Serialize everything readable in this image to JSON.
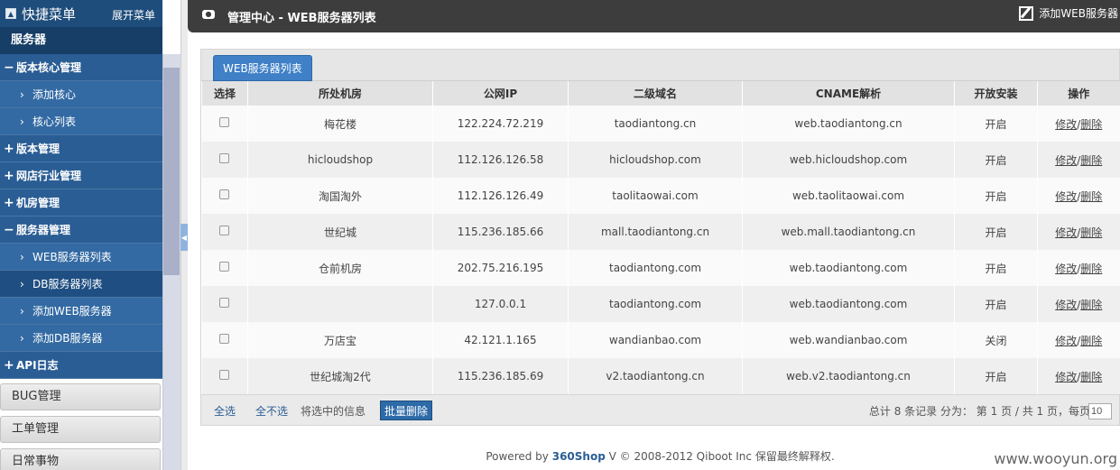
{
  "sidebar": {
    "title": "快捷菜单",
    "expand_label": "展开菜单",
    "group_label": "服务器",
    "items": [
      {
        "sign": "−",
        "label": "版本核心管理"
      },
      {
        "label": "添加核心"
      },
      {
        "label": "核心列表"
      },
      {
        "sign": "+",
        "label": "版本管理"
      },
      {
        "sign": "+",
        "label": "网店行业管理"
      },
      {
        "sign": "+",
        "label": "机房管理"
      },
      {
        "sign": "−",
        "label": "服务器管理"
      },
      {
        "label": "WEB服务器列表"
      },
      {
        "label": "DB服务器列表"
      },
      {
        "label": "添加WEB服务器"
      },
      {
        "label": "添加DB服务器"
      },
      {
        "sign": "+",
        "label": "API日志"
      }
    ],
    "bottom": [
      "BUG管理",
      "工单管理",
      "日常事物"
    ]
  },
  "header": {
    "title": "管理中心 - WEB服务器列表",
    "add_label": "添加WEB服务器"
  },
  "tab": {
    "label": "WEB服务器列表"
  },
  "table": {
    "headers": [
      "选择",
      "所处机房",
      "公网IP",
      "二级域名",
      "CNAME解析",
      "开放安装",
      "操作"
    ],
    "edit_label": "修改",
    "separator": "/",
    "delete_label": "删除",
    "rows": [
      {
        "room": "梅花楼",
        "ip": "122.224.72.219",
        "domain": "taodiantong.cn",
        "cname": "web.taodiantong.cn",
        "status": "开启"
      },
      {
        "room": "hicloudshop",
        "ip": "112.126.126.58",
        "domain": "hicloudshop.com",
        "cname": "web.hicloudshop.com",
        "status": "开启"
      },
      {
        "room": "淘国淘外",
        "ip": "112.126.126.49",
        "domain": "taolitaowai.com",
        "cname": "web.taolitaowai.com",
        "status": "开启"
      },
      {
        "room": "世纪城",
        "ip": "115.236.185.66",
        "domain": "mall.taodiantong.cn",
        "cname": "web.mall.taodiantong.cn",
        "status": "开启"
      },
      {
        "room": "仓前机房",
        "ip": "202.75.216.195",
        "domain": "taodiantong.com",
        "cname": "web.taodiantong.com",
        "status": "开启"
      },
      {
        "room": "",
        "ip": "127.0.0.1",
        "domain": "taodiantong.com",
        "cname": "web.taodiantong.com",
        "status": "开启"
      },
      {
        "room": "万店宝",
        "ip": "42.121.1.165",
        "domain": "wandianbao.com",
        "cname": "web.wandianbao.com",
        "status": "关闭"
      },
      {
        "room": "世纪城淘2代",
        "ip": "115.236.185.69",
        "domain": "v2.taodiantong.cn",
        "cname": "web.v2.taodiantong.cn",
        "status": "开启"
      }
    ]
  },
  "footer": {
    "select_all": "全选",
    "select_none": "全不选",
    "selected_info": "将选中的信息",
    "bulk_delete": "批量删除",
    "stats": "总计 8 条记录 分为： 第 1 页 / 共 1 页，每页",
    "per_page": "10"
  },
  "powered": {
    "prefix": "Powered by ",
    "brand": "360Shop",
    "suffix": " V © 2008-2012 Qiboot Inc 保留最终解释权."
  },
  "watermark": "www.wooyun.org"
}
